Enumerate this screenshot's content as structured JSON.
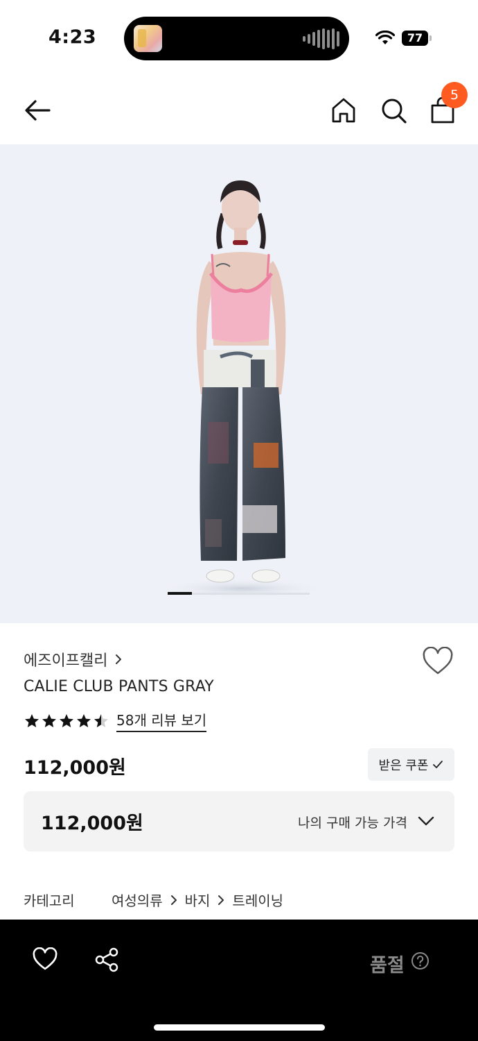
{
  "status_bar": {
    "time": "4:23",
    "battery": "77"
  },
  "nav": {
    "icons": [
      "back-icon",
      "home-icon",
      "search-icon",
      "shopping-bag-icon"
    ],
    "cart_count": "5"
  },
  "product_image": {
    "slide_progress": 0.17
  },
  "product": {
    "brand": "에즈이프캘리",
    "name": "CALIE CLUB PANTS GRAY",
    "rating": 4.5,
    "review_link": "58개 리뷰 보기",
    "price": "112,000원",
    "coupon_button": "받은 쿠폰",
    "my_price_value": "112,000원",
    "my_price_label": "나의 구매 가능 가격"
  },
  "category": {
    "label": "카테고리",
    "path": [
      "여성의류",
      "바지",
      "트레이닝"
    ]
  },
  "bottom_bar": {
    "status": "품절",
    "icons": [
      "heart-icon",
      "share-icon",
      "help-icon"
    ]
  },
  "colors": {
    "accent": "#ff5a1f",
    "image_bg": "#eef1f7",
    "bottom_bar_bg": "#000000",
    "soldout_text": "#8a8a8a"
  }
}
